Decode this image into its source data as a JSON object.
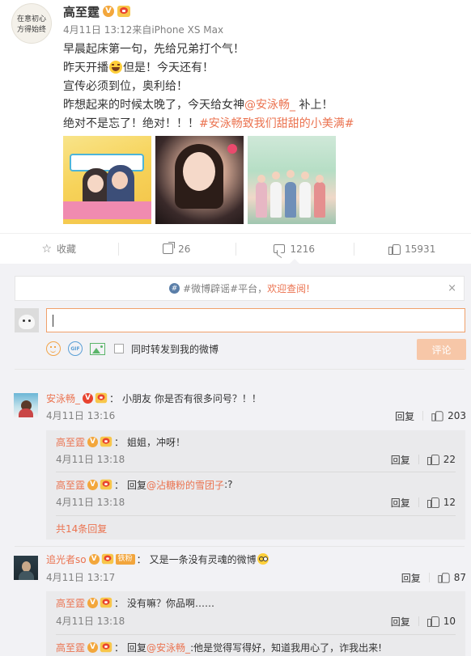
{
  "post": {
    "author": "高至霆",
    "avatar_text": [
      "在意初心",
      "方得始终"
    ],
    "time": "4月11日 13:12",
    "source": "来自iPhone XS Max",
    "lines": {
      "l1": "早晨起床第一句，先给兄弟打个气！",
      "l2a": "昨天开播",
      "l2b": "但是！今天还有！",
      "l3": "宣传必须到位，奥利给！",
      "l4a": "昨想起来的时候太晚了，今天给女神",
      "l4_mention": "@安泳畅_",
      "l4b": " 补上！",
      "l5a": "绝对不是忘了！绝对！！！",
      "l5_topic": "#安泳畅致我们甜甜的小美满#"
    }
  },
  "actions": {
    "favorite": "收藏",
    "repost_count": "26",
    "comment_count": "1216",
    "like_count": "15931"
  },
  "rumor_bar": {
    "prefix": "#微博辟谣#平台，",
    "link": "欢迎查阅!",
    "close": "×"
  },
  "composer": {
    "gif_label": "GIF",
    "checkbox_label": "同时转发到我的微博",
    "submit": "评论"
  },
  "comments": [
    {
      "name": "安泳畅_",
      "text": "小朋友 你是否有很多问号？！！",
      "time": "4月11日 13:16",
      "reply": "回复",
      "likes": "203",
      "replies": [
        {
          "name": "高至霆",
          "text": "姐姐，冲呀！",
          "time": "4月11日 13:18",
          "reply": "回复",
          "likes": "22"
        },
        {
          "name": "高至霆",
          "prefix": "回复",
          "mention": "@沾糖粉的雪团子",
          "text": ":?",
          "time": "4月11日 13:18",
          "reply": "回复",
          "likes": "12"
        }
      ],
      "more": "共14条回复"
    },
    {
      "name": "追光者so",
      "fan_badge": "铁粉",
      "text": "又是一条没有灵魂的微博",
      "time": "4月11日 13:17",
      "reply": "回复",
      "likes": "87",
      "replies": [
        {
          "name": "高至霆",
          "text": "没有嘛？你品啊……",
          "time": "4月11日 13:18",
          "reply": "回复",
          "likes": "10"
        },
        {
          "name": "高至霆",
          "prefix": "回复",
          "mention": "@安泳畅_",
          "text": ":他是觉得写得好，知道我用心了，诈我出来!"
        }
      ]
    }
  ],
  "colors": {
    "link": "#eb7350",
    "verified_gold": "#f3a73c",
    "verified_red": "#e8432f",
    "submit_disabled": "#f7c7a8",
    "comment_bg": "#f2f2f5"
  },
  "icons": [
    "verified-icon",
    "member-icon",
    "laugh-emoji-icon",
    "star-icon",
    "share-icon",
    "comment-icon",
    "like-icon",
    "hashtag-icon",
    "close-icon",
    "emoji-icon",
    "gif-icon",
    "image-icon",
    "checkbox-icon",
    "glasses-emoji-icon"
  ]
}
